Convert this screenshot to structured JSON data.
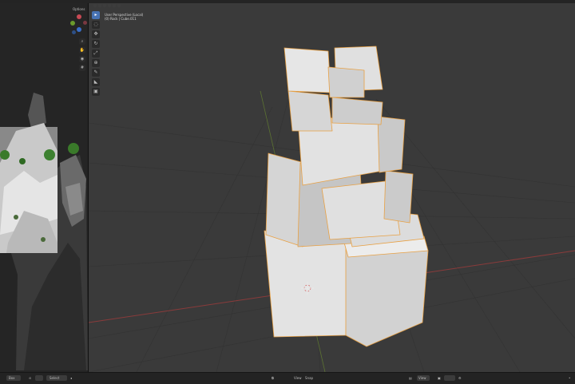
{
  "left_view": {
    "options_label": "Options"
  },
  "viewport": {
    "view_name": "User Perspective (Local)",
    "object_info": "(0) Rock | Cube.011"
  },
  "bottom_bar": {
    "mode_select": "Box",
    "view_label": "View",
    "select_label": "Select",
    "view_label_2": "View",
    "snap_label": "Snap"
  },
  "colors": {
    "viewport_bg": "#3a3a3a",
    "active_tool": "#4772b3",
    "x_axis": "#8a3b3b",
    "y_axis": "#6a8a2f",
    "selection_outline": "#e8a043"
  },
  "icons": {
    "gizmo_x": "x-axis-gizmo",
    "gizmo_y": "y-axis-gizmo",
    "gizmo_z": "z-axis-gizmo",
    "tools": [
      "cursor-icon",
      "select-box-icon",
      "move-icon",
      "rotate-icon",
      "scale-icon",
      "transform-icon",
      "annotate-icon",
      "measure-icon",
      "add-cube-icon"
    ]
  }
}
